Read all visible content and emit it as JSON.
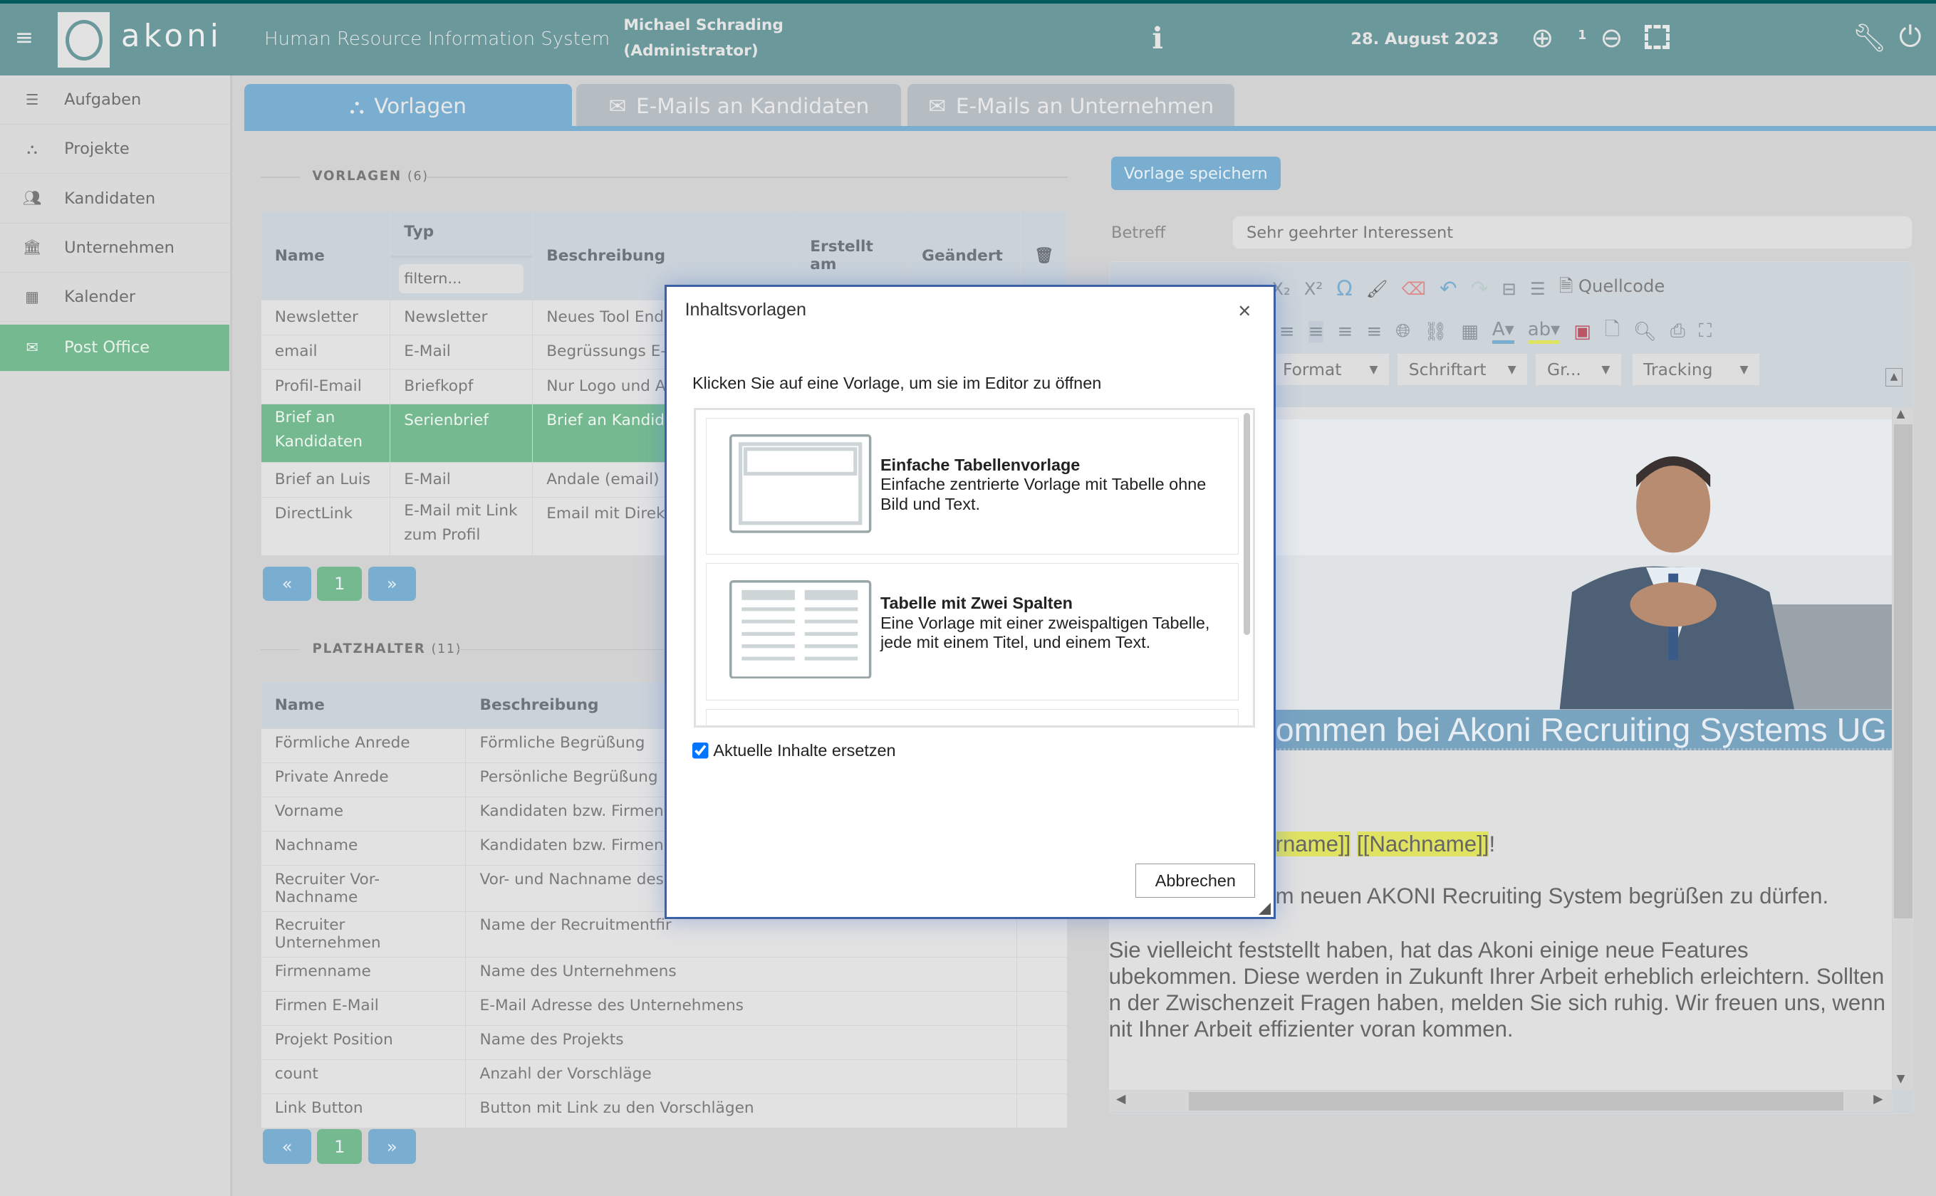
{
  "header": {
    "app_name": "akoni",
    "system_title": "Human Resource Information System",
    "user_name": "Michael Schrading",
    "user_role": "(Administrator)",
    "date": "28. August 2023",
    "zoom_level": "1"
  },
  "sidebar": {
    "items": [
      {
        "label": "Aufgaben",
        "icon": "list-icon"
      },
      {
        "label": "Projekte",
        "icon": "sitemap-icon"
      },
      {
        "label": "Kandidaten",
        "icon": "users-icon"
      },
      {
        "label": "Unternehmen",
        "icon": "bank-icon"
      },
      {
        "label": "Kalender",
        "icon": "calendar-icon"
      },
      {
        "label": "Post Office",
        "icon": "envelope-icon",
        "active": true
      }
    ]
  },
  "tabs": [
    {
      "label": "Vorlagen",
      "active": true
    },
    {
      "label": "E-Mails an Kandidaten"
    },
    {
      "label": "E-Mails an Unternehmen"
    }
  ],
  "vorlagen": {
    "title": "VORLAGEN",
    "count": "(6)",
    "columns": {
      "name": "Name",
      "typ": "Typ",
      "beschreibung": "Beschreibung",
      "erstellt": "Erstellt am",
      "geaendert": "Geändert"
    },
    "filter_placeholder": "filtern...",
    "rows": [
      {
        "name": "Newsletter",
        "typ": "Newsletter",
        "beschreibung": "Neues Tool End"
      },
      {
        "name": "email",
        "typ": "E-Mail",
        "beschreibung": "Begrüssungs E-"
      },
      {
        "name": "Profil-Email",
        "typ": "Briefkopf",
        "beschreibung": "Nur Logo und A"
      },
      {
        "name": "Brief an Kandidaten",
        "typ": "Serienbrief",
        "beschreibung": "Brief an Kandid",
        "selected": true
      },
      {
        "name": "Brief an Luis",
        "typ": "E-Mail",
        "beschreibung": "Andale (email)"
      },
      {
        "name": "DirectLink",
        "typ": "E-Mail mit Link zum Profil",
        "beschreibung": "Email mit Direkt"
      }
    ],
    "pagination": {
      "prev": "«",
      "page": "1",
      "next": "»"
    }
  },
  "platzhalter": {
    "title": "PLATZHALTER",
    "count": "(11)",
    "columns": {
      "name": "Name",
      "beschreibung": "Beschreibung"
    },
    "rows": [
      {
        "name": "Förmliche Anrede",
        "beschreibung": "Förmliche Begrüßung"
      },
      {
        "name": "Private Anrede",
        "beschreibung": "Persönliche Begrüßung"
      },
      {
        "name": "Vorname",
        "beschreibung": "Kandidaten bzw. Firmenk"
      },
      {
        "name": "Nachname",
        "beschreibung": "Kandidaten bzw. Firmenk"
      },
      {
        "name": "Recruiter Vor-Nachname",
        "beschreibung": "Vor- und Nachname des R"
      },
      {
        "name": "Recruiter Unternehmen",
        "beschreibung": "Name der Recruitmentfir"
      },
      {
        "name": "Firmenname",
        "beschreibung": "Name des Unternehmens"
      },
      {
        "name": "Firmen E-Mail",
        "beschreibung": "E-Mail Adresse des Unternehmens"
      },
      {
        "name": "Projekt Position",
        "beschreibung": "Name des Projekts"
      },
      {
        "name": "count",
        "beschreibung": "Anzahl der Vorschläge"
      },
      {
        "name": "Link Button",
        "beschreibung": "Button mit Link zu den Vorschlägen"
      }
    ],
    "pagination": {
      "prev": "«",
      "page": "1",
      "next": "»"
    }
  },
  "editor": {
    "save_button": "Vorlage speichern",
    "subject_label": "Betreff",
    "subject_value": "Sehr geehrter Interessent",
    "source_button": "Quellcode",
    "dropdowns": [
      "Format",
      "Schriftart",
      "Gr...",
      "Tracking"
    ],
    "heading": "ommen bei Akoni Recruiting Systems UG",
    "greeting_a": "rname]]",
    "greeting_b": "[[Nachname]]",
    "greeting_end": "!",
    "line1": "m neuen AKONI Recruiting System begrüßen zu dürfen.",
    "para": [
      "Sie vielleicht feststellt haben, hat das Akoni einige neue Features",
      "ubekommen. Diese werden in Zukunft Ihrer Arbeit erheblich erleichtern. Sollten",
      "n der Zwischenzeit Fragen haben, melden Sie sich ruhig. Wir freuen uns, wenn",
      "nit Ihner Arbeit effizienter voran kommen."
    ],
    "highlight_color": "#e0e262",
    "heading_color": "#79a4c0"
  },
  "modal": {
    "title": "Inhaltsvorlagen",
    "instruction": "Klicken Sie auf eine Vorlage, um sie im Editor zu öffnen",
    "templates": [
      {
        "title": "Einfache Tabellenvorlage",
        "description": "Einfache zentrierte Vorlage mit Tabelle ohne Bild und Text."
      },
      {
        "title": "Tabelle mit Zwei Spalten",
        "description": "Eine Vorlage mit einer zweispaltigen Tabelle, jede mit einem Titel, und einem Text."
      }
    ],
    "replace_label": "Aktuelle Inhalte ersetzen",
    "replace_checked": true,
    "cancel_button": "Abbrechen"
  },
  "colors": {
    "header": "#6a989b",
    "accent_blue": "#7aaed0",
    "accent_green": "#74b990",
    "modal_border": "#3a60a6"
  }
}
